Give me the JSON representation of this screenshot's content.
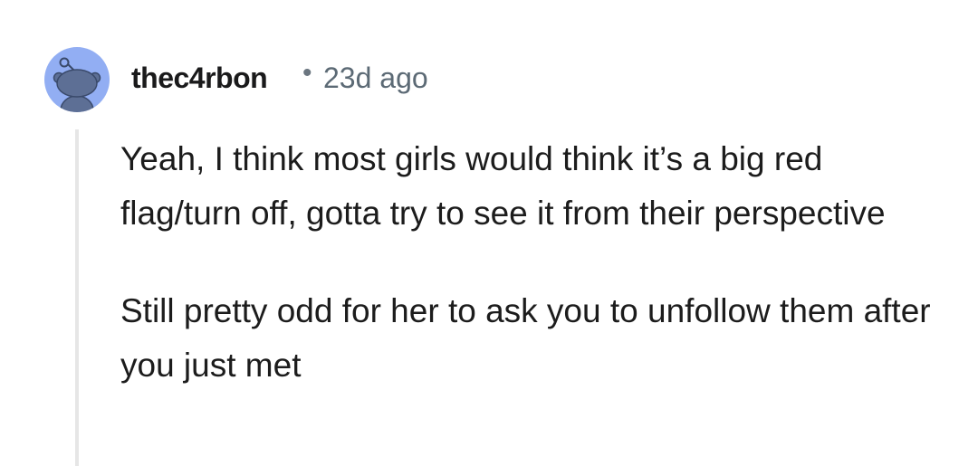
{
  "comment": {
    "author": "thec4rbon",
    "separator": "•",
    "time": "23d ago",
    "avatar_icon": "reddit-snoo-avatar-icon",
    "avatar_color": "#92aef3",
    "paragraphs": [
      "Yeah, I think most girls would think it’s a big red flag/turn off, gotta try to see it from their perspective",
      "Still pretty odd for her to ask you to unfollow them after you just met"
    ]
  }
}
